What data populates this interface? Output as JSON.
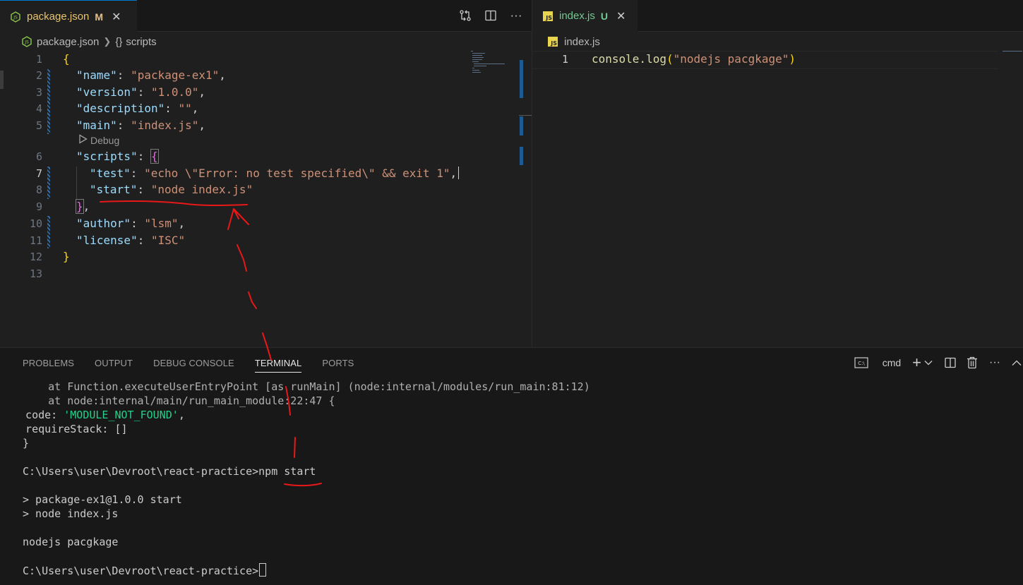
{
  "left_editor": {
    "tab": {
      "file_name": "package.json",
      "status": "M"
    },
    "breadcrumb": {
      "file": "package.json",
      "symbol": "scripts"
    },
    "line_numbers": [
      "1",
      "2",
      "3",
      "4",
      "5",
      "6",
      "7",
      "8",
      "9",
      "10",
      "11",
      "12",
      "13"
    ],
    "debug_lens": "Debug",
    "code": {
      "l1_open": "{",
      "l2_key": "\"name\"",
      "l2_val": "\"package-ex1\"",
      "l3_key": "\"version\"",
      "l3_val": "\"1.0.0\"",
      "l4_key": "\"description\"",
      "l4_val": "\"\"",
      "l5_key": "\"main\"",
      "l5_val": "\"index.js\"",
      "l6_key": "\"scripts\"",
      "l6_open": "{",
      "l7_key": "\"test\"",
      "l7_val": "\"echo \\\"Error: no test specified\\\" && exit 1\"",
      "l8_key": "\"start\"",
      "l8_val": "\"node index.js\"",
      "l9_close": "}",
      "l10_key": "\"author\"",
      "l10_val": "\"lsm\"",
      "l11_key": "\"license\"",
      "l11_val": "\"ISC\"",
      "l12_close": "}"
    }
  },
  "right_editor": {
    "tab": {
      "file_name": "index.js",
      "status": "U"
    },
    "breadcrumb": {
      "file": "index.js"
    },
    "line_numbers": [
      "1"
    ],
    "code": {
      "fn": "console.log",
      "open": "(",
      "arg": "\"nodejs pacgkage\"",
      "close": ")"
    }
  },
  "panel": {
    "tabs": [
      "PROBLEMS",
      "OUTPUT",
      "DEBUG CONSOLE",
      "TERMINAL",
      "PORTS"
    ],
    "active_tab": "TERMINAL",
    "shell_label": "cmd",
    "terminal": {
      "l1": "    at Function.executeUserEntryPoint [as runMain] (node:internal/modules/run_main:81:12)",
      "l2": "    at node:internal/main/run_main_module:22:47 {",
      "l3_a": "  code: ",
      "l3_b": "'MODULE_NOT_FOUND'",
      "l3_c": ",",
      "l4": "  requireStack: []",
      "l5": "}",
      "l6": "C:\\Users\\user\\Devroot\\react-practice>npm start",
      "l7": "> package-ex1@1.0.0 start",
      "l8": "> node index.js",
      "l9": "nodejs pacgkage",
      "l10": "C:\\Users\\user\\Devroot\\react-practice>"
    }
  },
  "colors": {
    "annotation": "#e81818",
    "accent": "#0078d4",
    "modified": "#e2c08d",
    "untracked": "#73c991"
  }
}
